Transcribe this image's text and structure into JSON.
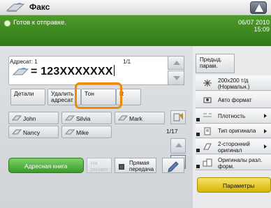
{
  "title": {
    "text": "Факс"
  },
  "status": {
    "message": "Готов к отправке.",
    "date": "06/07 2010",
    "time": "15:09"
  },
  "address": {
    "label": "Адресат: 1",
    "page": "1/1",
    "number": "= 123XXXXXXX"
  },
  "tabs": {
    "detail": "Детали",
    "delete": "Удалить адресат",
    "ton": "Тон",
    "r": "R"
  },
  "recipients": [
    {
      "name": "John"
    },
    {
      "name": "Silvia"
    },
    {
      "name": "Mark"
    },
    {
      "name": "Nancy"
    },
    {
      "name": "Mike"
    }
  ],
  "grid": {
    "count": "1/17"
  },
  "bottom": {
    "book": "Адресная книга",
    "dial": "На рычаге",
    "direct": "Прямая передача"
  },
  "settings": {
    "prev": "Предыд. парам.",
    "resolution": "200x200 т/д (Нормальн.)",
    "auto_format": "Авто формат",
    "density": "Плотность",
    "original_type": "Тип оригинала",
    "duplex": "2-сторонний оригинал",
    "mixed": "Оригиналы разл. форм.",
    "params": "Параметры"
  },
  "colors": {
    "accent": "#3a9b26",
    "highlight": "#f08a00",
    "params": "#e8c820"
  }
}
